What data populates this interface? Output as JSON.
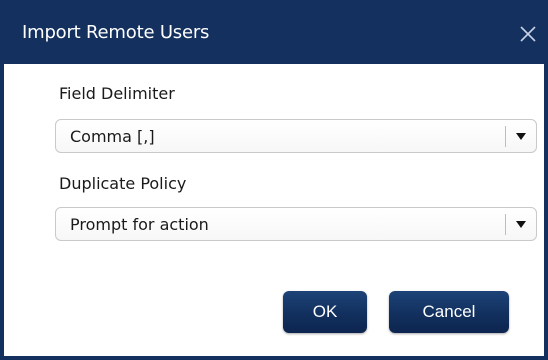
{
  "dialog": {
    "title": "Import Remote Users",
    "close_icon": "close-icon"
  },
  "fields": {
    "delimiter": {
      "label": "Field Delimiter",
      "value": "Comma [,]"
    },
    "duplicate_policy": {
      "label": "Duplicate Policy",
      "value": "Prompt for action"
    }
  },
  "buttons": {
    "ok_label": "OK",
    "cancel_label": "Cancel"
  },
  "colors": {
    "titlebar": "#13305f",
    "button": "#12305e",
    "text": "#1a1a1a"
  }
}
